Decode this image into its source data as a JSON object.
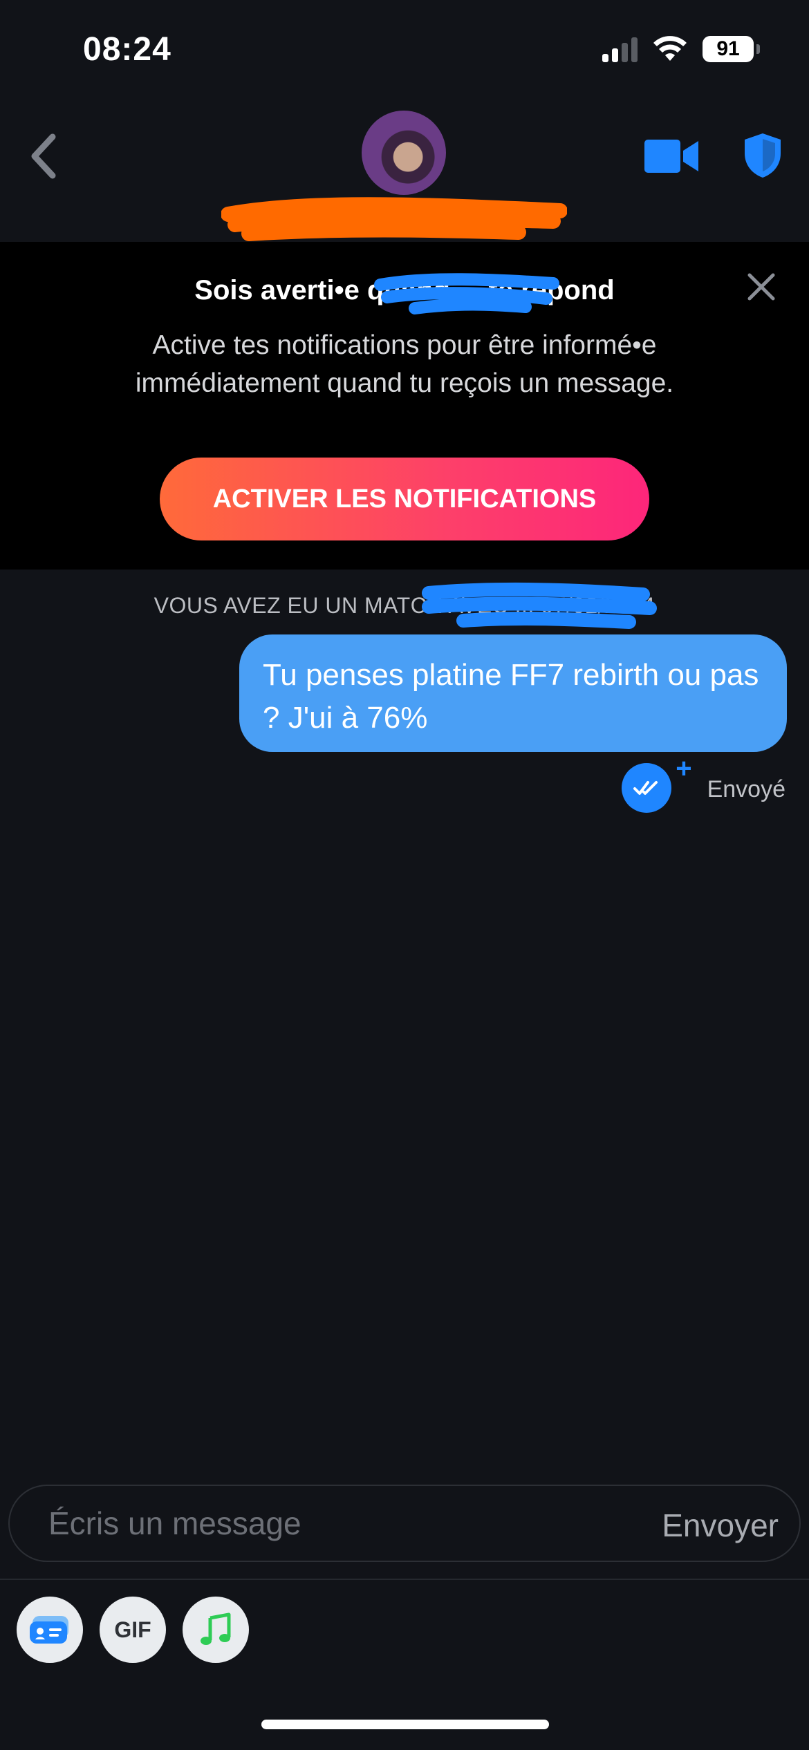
{
  "status_bar": {
    "time": "08:24",
    "battery": "91"
  },
  "header": {
    "icons": [
      "chevron-left-icon",
      "avatar",
      "video-camera-icon",
      "shield-icon"
    ]
  },
  "banner": {
    "title": "Sois averti•e quand ... te répond",
    "body": "Active tes notifications pour être informé•e immédiatement quand tu reçois un message.",
    "button_label": "ACTIVER LES NOTIFICATIONS",
    "button_gradient": [
      "#ff6a3a",
      "#fd267a"
    ]
  },
  "chat": {
    "match_notice": "VOUS AVEZ EU UN MATCH AVEC ... 07/02/2024",
    "messages": [
      {
        "text": "Tu penses platine FF7 rebirth ou pas ? J'ui à 76%",
        "status": "Envoyé"
      }
    ]
  },
  "composer": {
    "placeholder": "Écris un message",
    "send_label": "Envoyer",
    "tools": [
      {
        "name": "profile-card-icon"
      },
      {
        "name": "gif",
        "label": "GIF"
      },
      {
        "name": "music-note-icon"
      }
    ]
  },
  "colors": {
    "accent": "#1f86ff",
    "bubble": "#4a9ff5",
    "background": "#111318"
  }
}
